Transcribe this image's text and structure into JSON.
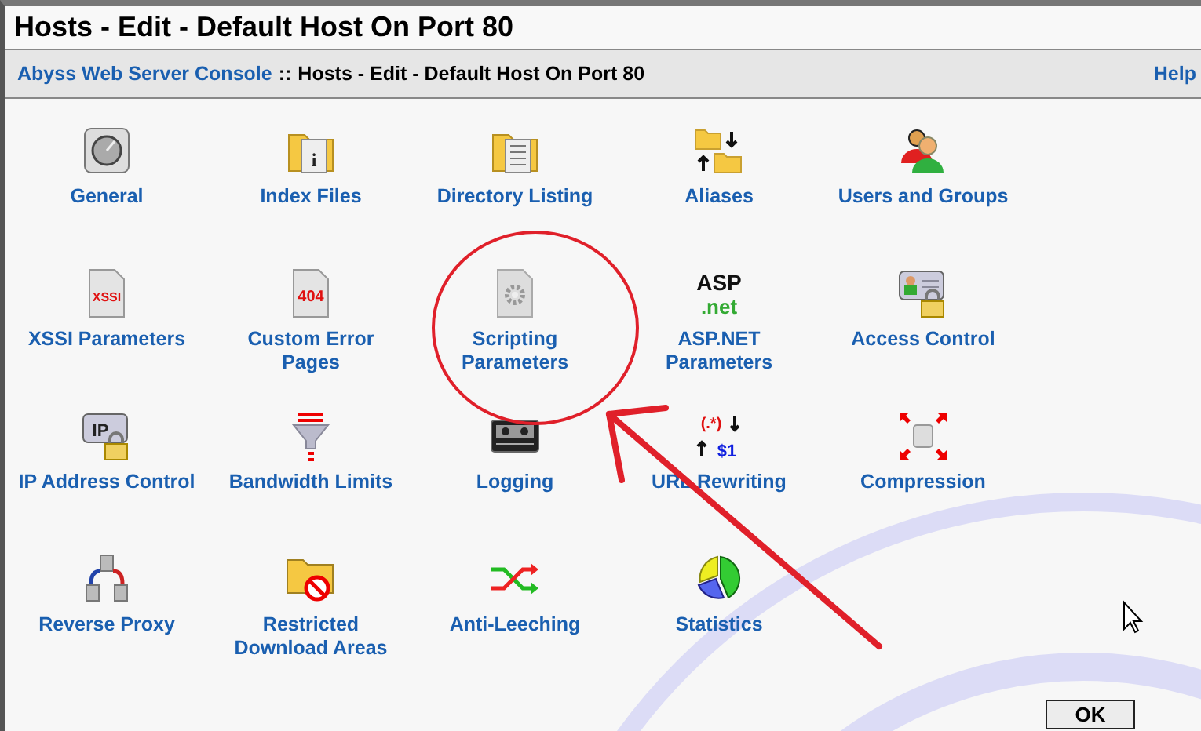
{
  "window": {
    "title": "Hosts - Edit - Default Host On Port 80"
  },
  "breadcrumb": {
    "link": "Abyss Web Server Console",
    "separator": "::",
    "current": "Hosts - Edit - Default Host On Port 80",
    "help": "Help"
  },
  "items": [
    {
      "label": "General",
      "kind": "gauge"
    },
    {
      "label": "Index Files",
      "kind": "folder-info",
      "icon_text": [
        "i"
      ]
    },
    {
      "label": "Directory Listing",
      "kind": "folder-list"
    },
    {
      "label": "Aliases",
      "kind": "folder-arrows"
    },
    {
      "label": "Users and Groups",
      "kind": "users"
    },
    {
      "label": "XSSI Parameters",
      "kind": "doc-text",
      "icon_text": [
        "XSSI"
      ]
    },
    {
      "label": "Custom Error Pages",
      "kind": "doc-text",
      "icon_text": [
        "404"
      ]
    },
    {
      "label": "Scripting Parameters",
      "kind": "doc-gear"
    },
    {
      "label": "ASP.NET Parameters",
      "kind": "aspnet",
      "icon_text": [
        "ASP",
        ".net"
      ]
    },
    {
      "label": "Access Control",
      "kind": "id-lock"
    },
    {
      "label": "IP Address Control",
      "kind": "ip-lock",
      "icon_text": [
        "IP"
      ]
    },
    {
      "label": "Bandwidth Limits",
      "kind": "funnel"
    },
    {
      "label": "Logging",
      "kind": "tape"
    },
    {
      "label": "URL Rewriting",
      "kind": "regex",
      "icon_text": [
        "(.*)",
        "$1"
      ]
    },
    {
      "label": "Compression",
      "kind": "compress"
    },
    {
      "label": "Reverse Proxy",
      "kind": "servers"
    },
    {
      "label": "Restricted Download Areas",
      "kind": "folder-block"
    },
    {
      "label": "Anti-Leeching",
      "kind": "shuffle"
    },
    {
      "label": "Statistics",
      "kind": "pie"
    }
  ],
  "buttons": [
    "OK"
  ]
}
